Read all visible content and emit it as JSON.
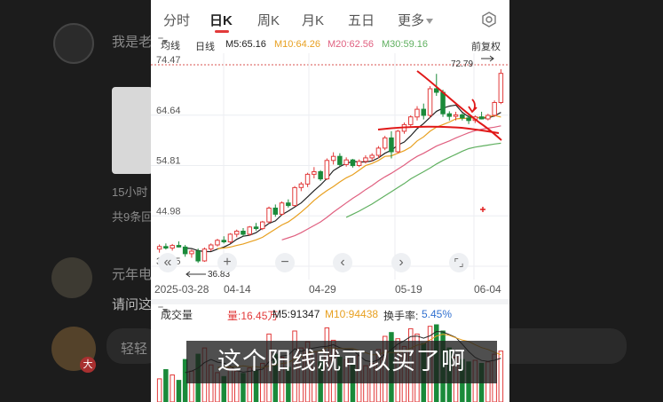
{
  "tabs": [
    "分时",
    "日K",
    "周K",
    "月K",
    "五日",
    "更多"
  ],
  "ma_bar": {
    "selector": "均线",
    "line_type": "日线",
    "ma5": "M5:65.16",
    "ma10": "M10:64.26",
    "ma20": "M20:62.56",
    "ma30": "M30:59.16",
    "adjust": "前复权"
  },
  "price_axis": [
    "74.47",
    "64.64",
    "54.81",
    "44.98",
    "35.15"
  ],
  "annotations": {
    "high": "72.79",
    "low": "36.83"
  },
  "dates": [
    "2025-03-28",
    "04-14",
    "04-29",
    "05-19",
    "06-04"
  ],
  "volume_bar": {
    "selector": "成交量",
    "current": "量:16.45万",
    "m5": "M5:91347",
    "m10": "M10:94438",
    "turnover_label": "换手率:",
    "turnover_value": "5.45%"
  },
  "subtitle": "这个阳线就可以买了啊",
  "background": {
    "text1": "我是老",
    "text2": "15小时",
    "text3": "共9条回",
    "text4": "元年电",
    "text5": "请问这",
    "text6": "轻轻",
    "badge": "大"
  },
  "colors": {
    "up": "#e23a3a",
    "down": "#1a8a3a",
    "ma5": "#222222",
    "ma10": "#e8a020",
    "ma20": "#e06080",
    "ma30": "#60b060",
    "accent": "#e23a3a",
    "turnover": "#3070d0"
  },
  "chart_data": {
    "type": "candlestick",
    "ylim": [
      35.15,
      74.47
    ],
    "y_ticks": [
      74.47,
      64.64,
      54.81,
      44.98,
      35.15
    ],
    "candles": [
      [
        38.5,
        39.4,
        37.8,
        39.0
      ],
      [
        39.0,
        39.6,
        38.4,
        38.7
      ],
      [
        38.7,
        39.5,
        38.2,
        39.2
      ],
      [
        39.2,
        40.0,
        38.8,
        38.9
      ],
      [
        38.9,
        39.3,
        37.0,
        37.6
      ],
      [
        37.6,
        38.4,
        36.8,
        38.1
      ],
      [
        38.1,
        38.6,
        35.8,
        36.2
      ],
      [
        36.2,
        38.8,
        36.0,
        38.5
      ],
      [
        38.5,
        39.6,
        38.1,
        39.3
      ],
      [
        39.3,
        40.5,
        39.0,
        40.2
      ],
      [
        40.2,
        41.0,
        39.6,
        39.9
      ],
      [
        39.9,
        41.6,
        39.6,
        41.4
      ],
      [
        41.4,
        42.3,
        40.8,
        42.0
      ],
      [
        42.0,
        42.6,
        41.0,
        41.4
      ],
      [
        41.4,
        43.0,
        41.1,
        42.8
      ],
      [
        42.8,
        43.6,
        42.1,
        42.5
      ],
      [
        42.5,
        44.0,
        42.2,
        43.8
      ],
      [
        43.8,
        46.8,
        43.5,
        46.5
      ],
      [
        46.5,
        47.2,
        44.8,
        45.3
      ],
      [
        45.3,
        47.8,
        45.0,
        47.5
      ],
      [
        47.5,
        48.2,
        46.6,
        47.0
      ],
      [
        47.0,
        50.8,
        46.8,
        50.5
      ],
      [
        50.5,
        51.6,
        49.8,
        51.2
      ],
      [
        51.2,
        53.4,
        50.6,
        53.1
      ],
      [
        53.1,
        54.5,
        52.3,
        53.6
      ],
      [
        53.6,
        53.9,
        51.8,
        52.2
      ],
      [
        52.2,
        56.2,
        52.0,
        55.8
      ],
      [
        55.8,
        57.4,
        55.0,
        56.6
      ],
      [
        56.6,
        57.2,
        54.6,
        55.0
      ],
      [
        55.0,
        56.4,
        54.6,
        55.9
      ],
      [
        55.9,
        56.1,
        54.4,
        54.8
      ],
      [
        54.8,
        56.0,
        54.5,
        55.6
      ],
      [
        55.6,
        56.8,
        55.2,
        56.3
      ],
      [
        56.3,
        57.2,
        55.6,
        56.8
      ],
      [
        56.8,
        58.6,
        56.2,
        58.2
      ],
      [
        58.2,
        60.6,
        57.8,
        60.2
      ],
      [
        60.2,
        61.5,
        56.2,
        57.5
      ],
      [
        57.5,
        61.8,
        57.2,
        61.5
      ],
      [
        61.5,
        63.2,
        61.0,
        62.8
      ],
      [
        62.8,
        64.6,
        62.4,
        64.3
      ],
      [
        64.3,
        66.4,
        63.6,
        65.8
      ],
      [
        65.8,
        66.9,
        63.8,
        64.6
      ],
      [
        64.6,
        70.3,
        64.1,
        69.8
      ],
      [
        69.8,
        72.7,
        68.4,
        69.1
      ],
      [
        69.1,
        69.6,
        64.3,
        64.9
      ],
      [
        64.9,
        65.4,
        63.6,
        64.4
      ],
      [
        64.4,
        65.3,
        63.6,
        64.7
      ],
      [
        64.7,
        65.0,
        63.6,
        64.1
      ],
      [
        64.1,
        64.8,
        62.9,
        63.6
      ],
      [
        63.6,
        64.6,
        63.1,
        64.3
      ],
      [
        64.3,
        65.3,
        63.8,
        63.9
      ],
      [
        63.9,
        64.9,
        63.6,
        64.6
      ],
      [
        64.6,
        67.5,
        64.3,
        67.1
      ],
      [
        67.1,
        73.6,
        66.8,
        72.79
      ]
    ],
    "volumes": [
      30,
      42,
      35,
      28,
      55,
      40,
      62,
      70,
      48,
      38,
      33,
      45,
      40,
      37,
      44,
      41,
      50,
      88,
      62,
      58,
      45,
      92,
      70,
      78,
      65,
      52,
      96,
      80,
      58,
      55,
      48,
      60,
      47,
      50,
      68,
      85,
      90,
      82,
      72,
      95,
      88,
      76,
      98,
      100,
      92,
      70,
      58,
      55,
      52,
      54,
      50,
      52,
      62,
      66
    ],
    "ma_lines": {
      "ma5": [
        null,
        null,
        null,
        null,
        38.7,
        38.6,
        38.2,
        38.0,
        38.0,
        38.5,
        38.9,
        39.5,
        40.4,
        41.0,
        41.2,
        41.7,
        42.6,
        43.5,
        44.0,
        45.2,
        45.9,
        46.7,
        47.5,
        48.7,
        49.9,
        51.0,
        52.3,
        53.8,
        54.6,
        55.2,
        55.6,
        55.5,
        55.5,
        55.7,
        56.3,
        57.2,
        57.8,
        58.8,
        59.4,
        60.6,
        62.0,
        63.0,
        64.2,
        65.4,
        66.0,
        66.4,
        66.6,
        65.2,
        64.3,
        64.2,
        64.1,
        64.1,
        64.5,
        65.16
      ],
      "ma10": [
        null,
        null,
        null,
        null,
        null,
        null,
        null,
        null,
        null,
        38.6,
        38.7,
        38.9,
        39.2,
        39.5,
        39.9,
        40.3,
        40.8,
        41.6,
        42.4,
        43.2,
        43.8,
        44.7,
        45.7,
        46.8,
        48.0,
        49.0,
        49.9,
        50.7,
        51.6,
        52.4,
        53.0,
        53.9,
        54.8,
        55.2,
        55.8,
        56.6,
        56.7,
        57.2,
        57.7,
        58.4,
        59.6,
        60.4,
        61.5,
        62.3,
        62.8,
        63.3,
        63.9,
        64.0,
        64.0,
        64.2,
        64.2,
        64.3,
        64.6,
        64.26
      ],
      "ma20": [
        null,
        null,
        null,
        null,
        null,
        null,
        null,
        null,
        null,
        null,
        null,
        null,
        null,
        null,
        null,
        null,
        null,
        null,
        null,
        40.3,
        40.7,
        41.1,
        41.7,
        42.4,
        43.1,
        43.8,
        44.7,
        45.7,
        46.6,
        47.5,
        48.4,
        49.2,
        50.1,
        50.9,
        51.8,
        52.6,
        53.3,
        54.1,
        54.9,
        55.8,
        56.6,
        57.2,
        57.9,
        58.6,
        59.1,
        59.6,
        60.2,
        60.7,
        61.2,
        61.6,
        61.9,
        62.1,
        62.3,
        62.56
      ],
      "ma30": [
        null,
        null,
        null,
        null,
        null,
        null,
        null,
        null,
        null,
        null,
        null,
        null,
        null,
        null,
        null,
        null,
        null,
        null,
        null,
        null,
        null,
        null,
        null,
        null,
        null,
        null,
        null,
        null,
        null,
        44.7,
        45.3,
        45.9,
        46.6,
        47.3,
        48.1,
        48.9,
        49.7,
        50.5,
        51.3,
        52.2,
        52.9,
        53.6,
        54.3,
        55.1,
        55.8,
        56.4,
        57.0,
        57.6,
        58.1,
        58.4,
        58.6,
        58.8,
        59.0,
        59.16
      ]
    }
  }
}
